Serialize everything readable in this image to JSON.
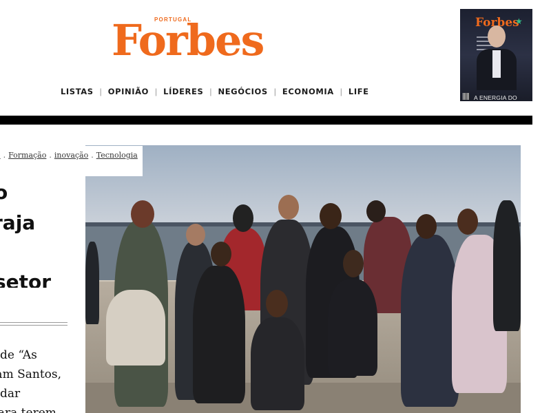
{
  "header": {
    "logo_super": "PORTUGAL",
    "logo": "Forbes",
    "nav": [
      {
        "label": "LISTAS"
      },
      {
        "label": "OPINIÃO"
      },
      {
        "label": "LÍDERES"
      },
      {
        "label": "NEGÓCIOS"
      },
      {
        "label": "ECONOMIA"
      },
      {
        "label": "LIFE"
      }
    ],
    "nav_separator": "|",
    "cover": {
      "masthead": "Forbes",
      "tagline": "A ENERGIA DO FUTURO"
    }
  },
  "article": {
    "tags": [
      {
        "label": "o"
      },
      {
        "label": "Formação"
      },
      {
        "label": "inovação"
      },
      {
        "label": "Tecnologia"
      }
    ],
    "tag_separator": ".",
    "headline_lines": [
      "o",
      "raja",
      "",
      "setor"
    ],
    "excerpt_lines": [
      "de “As",
      "iam Santos,",
      "dar",
      "para terem"
    ],
    "photo_alt": "group photo"
  },
  "colors": {
    "brand": "#ef6a1d",
    "rule": "#000000",
    "text": "#111111"
  }
}
